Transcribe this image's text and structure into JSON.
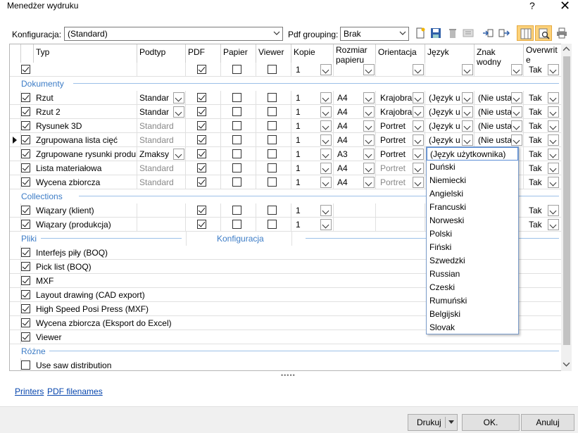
{
  "window": {
    "title": "Menedżer wydruku",
    "help": "?",
    "close": "✕"
  },
  "toolbar": {
    "config_label": "Konfiguracja:",
    "config_value": "(Standard)",
    "pdf_grouping_label": "Pdf grouping:",
    "pdf_grouping_value": "Brak"
  },
  "columns": {
    "typ": "Typ",
    "podtyp": "Podtyp",
    "pdf": "PDF",
    "papier": "Papier",
    "viewer": "Viewer",
    "kopie": "Kopie",
    "rozmiar1": "Rozmiar",
    "rozmiar2": "papieru",
    "orientacja": "Orientacja",
    "jezyk": "Język",
    "znak": "Znak wodny",
    "overwrite1": "Overwrit",
    "overwrite2": "e"
  },
  "header_row": {
    "kopie": "1",
    "overwrite": "Tak"
  },
  "sections": {
    "dokumenty": "Dokumenty",
    "collections": "Collections",
    "pliki": "Pliki",
    "konfiguracja": "Konfiguracja",
    "rozne": "Różne"
  },
  "dokumenty": [
    {
      "typ": "Rzut",
      "podtyp": "Standar",
      "podtyp_gray": false,
      "podtyp_dd": true,
      "kopie": "1",
      "rozmiar": "A4",
      "orient": "Krajobra",
      "jezyk": "(Język u",
      "znak": "(Nie usta",
      "ow": "Tak"
    },
    {
      "typ": "Rzut 2",
      "podtyp": "Standar",
      "podtyp_gray": false,
      "podtyp_dd": true,
      "kopie": "1",
      "rozmiar": "A4",
      "orient": "Krajobra",
      "jezyk": "(Język u",
      "znak": "(Nie usta",
      "ow": "Tak"
    },
    {
      "typ": "Rysunek 3D",
      "podtyp": "Standard",
      "podtyp_gray": true,
      "podtyp_dd": false,
      "kopie": "1",
      "rozmiar": "A4",
      "orient": "Portret",
      "jezyk": "(Język u",
      "znak": "(Nie usta",
      "ow": "Tak"
    },
    {
      "typ": "Zgrupowana lista cięć",
      "podtyp": "Standard",
      "podtyp_gray": true,
      "podtyp_dd": false,
      "kopie": "1",
      "rozmiar": "A4",
      "orient": "Portret",
      "jezyk": "(Język u",
      "znak": "(Nie usta",
      "ow": "Tak"
    },
    {
      "typ": "Zgrupowane rysunki produkc",
      "podtyp": "Zmaksy",
      "podtyp_gray": false,
      "podtyp_dd": true,
      "kopie": "1",
      "rozmiar": "A3",
      "orient": "Portret",
      "jezyk": "",
      "znak": "",
      "ow": "Tak"
    },
    {
      "typ": "Lista materiałowa",
      "podtyp": "Standard",
      "podtyp_gray": true,
      "podtyp_dd": false,
      "kopie": "1",
      "rozmiar": "A4",
      "orient": "Portret",
      "jezyk": "",
      "znak": "",
      "ow": "Tak"
    },
    {
      "typ": "Wycena zbiorcza",
      "podtyp": "Standard",
      "podtyp_gray": true,
      "podtyp_dd": false,
      "kopie": "1",
      "rozmiar": "A4",
      "orient": "Portret",
      "jezyk": "",
      "znak": "",
      "ow": "Tak"
    }
  ],
  "collections": [
    {
      "typ": "Wiązary (klient)",
      "kopie": "1",
      "ow": "Tak"
    },
    {
      "typ": "Wiązary (produkcja)",
      "kopie": "1",
      "ow": "Tak"
    }
  ],
  "pliki": [
    "Interfejs piły (BOQ)",
    "Pick list (BOQ)",
    "MXF",
    "Layout drawing (CAD export)",
    "High Speed Posi Press (MXF)",
    "Wycena zbiorcza (Eksport do Excel)",
    "Viewer"
  ],
  "rozne": [
    "Use saw distribution"
  ],
  "language_options": [
    "(Język użytkownika)",
    "Duński",
    "Niemiecki",
    "Angielski",
    "Francuski",
    "Norweski",
    "Polski",
    "Fiński",
    "Szwedzki",
    "Russian",
    "Czeski",
    "Rumuński",
    "Belgijski",
    "Slovak"
  ],
  "splitter": "•••••",
  "links": {
    "printers": "Printers",
    "pdf_filenames": "PDF filenames"
  },
  "buttons": {
    "drukuj": "Drukuj",
    "ok": "OK.",
    "anuluj": "Anuluj"
  }
}
